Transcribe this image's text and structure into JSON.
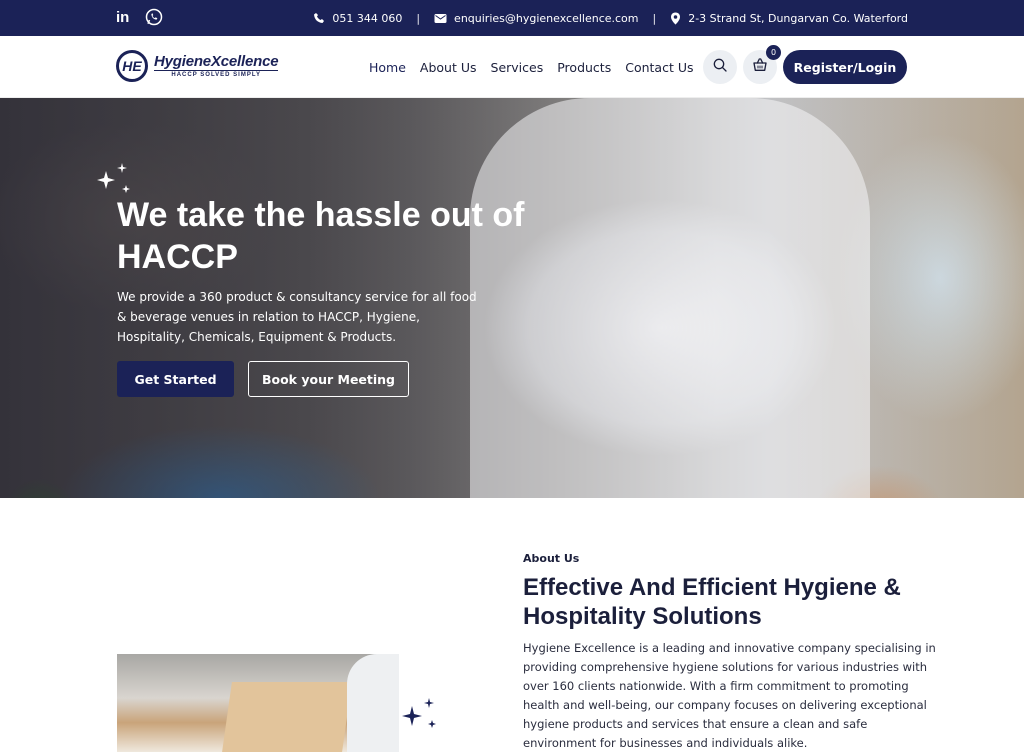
{
  "topbar": {
    "social": [
      "linkedin-icon",
      "whatsapp-icon"
    ],
    "linkedin_text": "in",
    "phone": "051 344 060",
    "email": "enquiries@hygienexcellence.com",
    "address": "2-3 Strand St, Dungarvan Co. Waterford",
    "separator": "|"
  },
  "header": {
    "logo_name": "HygieneXcellence",
    "logo_mark": "HE",
    "logo_tagline": "HACCP SOLVED SIMPLY",
    "nav": [
      "Home",
      "About Us",
      "Services",
      "Products",
      "Contact Us"
    ],
    "cart_count": "0",
    "register_label": "Register/Login"
  },
  "hero": {
    "title": "We take the hassle out of HACCP",
    "description": "We provide a 360 product & consultancy service for all food & beverage venues in relation to HACCP, Hygiene, Hospitality, Chemicals, Equipment & Products.",
    "primary_button": "Get Started",
    "secondary_button": "Book your Meeting"
  },
  "about": {
    "label": "About Us",
    "title": "Effective And Efficient Hygiene & Hospitality Solutions",
    "text": "Hygiene Excellence is a leading and innovative company specialising in providing comprehensive hygiene solutions for various industries with over 160 clients nationwide. With a firm commitment to promoting health and well-being, our company focuses on delivering exceptional hygiene products and services that ensure a clean and safe environment for businesses and individuals alike."
  },
  "colors": {
    "brand_navy": "#1b2257",
    "white": "#ffffff"
  }
}
